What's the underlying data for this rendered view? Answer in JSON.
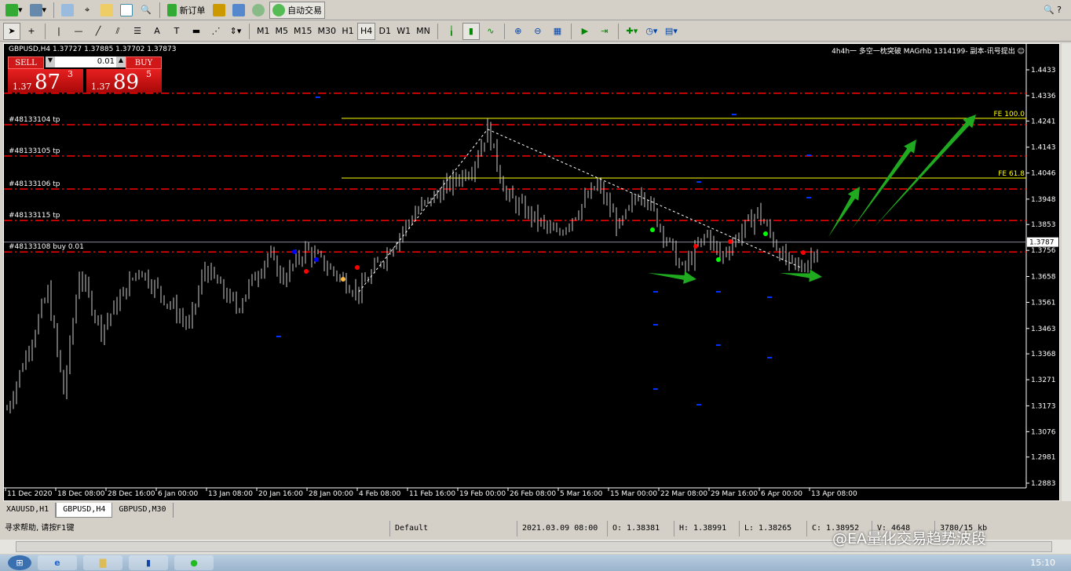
{
  "toolbar1": {
    "new_order": "新订单",
    "auto_trading": "自动交易"
  },
  "toolbar2": {
    "timeframes": [
      "M1",
      "M5",
      "M15",
      "M30",
      "H1",
      "H4",
      "D1",
      "W1",
      "MN"
    ],
    "active": "H4"
  },
  "chart": {
    "header": "GBPUSD,H4  1.37727 1.37885 1.37702 1.37873",
    "indicator_text": "4h4h一 多空一枕突破  MAGrhb 1314199- 副本-讯号提出 ☺",
    "sell_label": "SELL",
    "buy_label": "BUY",
    "lot": "0.01",
    "sell_price": {
      "small": "1.37",
      "big": "87",
      "pip": "3"
    },
    "buy_price": {
      "small": "1.37",
      "big": "89",
      "pip": "5"
    },
    "current_price": "1.3787",
    "fe_levels": [
      {
        "label": "FE 100.0",
        "price": 1.4251
      },
      {
        "label": "FE 61.8",
        "price": 1.4027
      }
    ],
    "order_lines": [
      {
        "label": "#48133104 tp",
        "price": 1.4227
      },
      {
        "label": "#48133105 tp",
        "price": 1.411
      },
      {
        "label": "#48133106 tp",
        "price": 1.3986
      },
      {
        "label": "#48133115 tp",
        "price": 1.3868
      },
      {
        "label": "#48133108 buy 0.01",
        "price": 1.375
      },
      {
        "label": "",
        "price": 1.4345
      }
    ],
    "price_ticks": [
      "1.4433",
      "1.4336",
      "1.4241",
      "1.4143",
      "1.4046",
      "1.3948",
      "1.3853",
      "1.3756",
      "1.3658",
      "1.3561",
      "1.3463",
      "1.3368",
      "1.3271",
      "1.3173",
      "1.3076",
      "1.2981",
      "1.2883"
    ],
    "date_ticks": [
      "11 Dec 2020",
      "18 Dec 08:00",
      "28 Dec 16:00",
      "6 Jan 00:00",
      "13 Jan 08:00",
      "20 Jan 16:00",
      "28 Jan 00:00",
      "4 Feb 08:00",
      "11 Feb 16:00",
      "19 Feb 00:00",
      "26 Feb 08:00",
      "5 Mar 16:00",
      "15 Mar 00:00",
      "22 Mar 08:00",
      "29 Mar 16:00",
      "6 Apr 00:00",
      "13 Apr 08:00"
    ]
  },
  "chart_data": {
    "type": "candlestick",
    "symbol": "GBPUSD",
    "timeframe": "H4",
    "ylim": [
      1.2883,
      1.4433
    ],
    "path": [
      [
        0,
        1.316
      ],
      [
        13,
        1.36
      ],
      [
        18,
        1.322
      ],
      [
        23,
        1.367
      ],
      [
        30,
        1.346
      ],
      [
        42,
        1.369
      ],
      [
        58,
        1.347
      ],
      [
        63,
        1.369
      ],
      [
        73,
        1.354
      ],
      [
        83,
        1.374
      ],
      [
        88,
        1.365
      ],
      [
        95,
        1.376
      ],
      [
        112,
        1.36
      ],
      [
        130,
        1.39
      ],
      [
        148,
        1.407
      ],
      [
        153,
        1.421
      ],
      [
        159,
        1.396
      ],
      [
        175,
        1.381
      ],
      [
        188,
        1.4
      ],
      [
        195,
        1.384
      ],
      [
        202,
        1.399
      ],
      [
        215,
        1.368
      ],
      [
        223,
        1.382
      ],
      [
        227,
        1.373
      ],
      [
        239,
        1.39
      ],
      [
        248,
        1.371
      ],
      [
        253,
        1.369
      ],
      [
        259,
        1.3787
      ]
    ]
  },
  "tabs": [
    "XAUUSD,H1",
    "GBPUSD,H4",
    "GBPUSD,M30"
  ],
  "status": {
    "help": "寻求帮助, 请按F1键",
    "profile": "Default",
    "datetime": "2021.03.09 08:00",
    "open": "O: 1.38381",
    "high": "H: 1.38991",
    "low": "L: 1.38265",
    "close": "C: 1.38952",
    "volume": "V: 4648",
    "conn": "3780/15 kb"
  },
  "watermark": "@EA量化交易趋势波段",
  "clock": "15:10"
}
